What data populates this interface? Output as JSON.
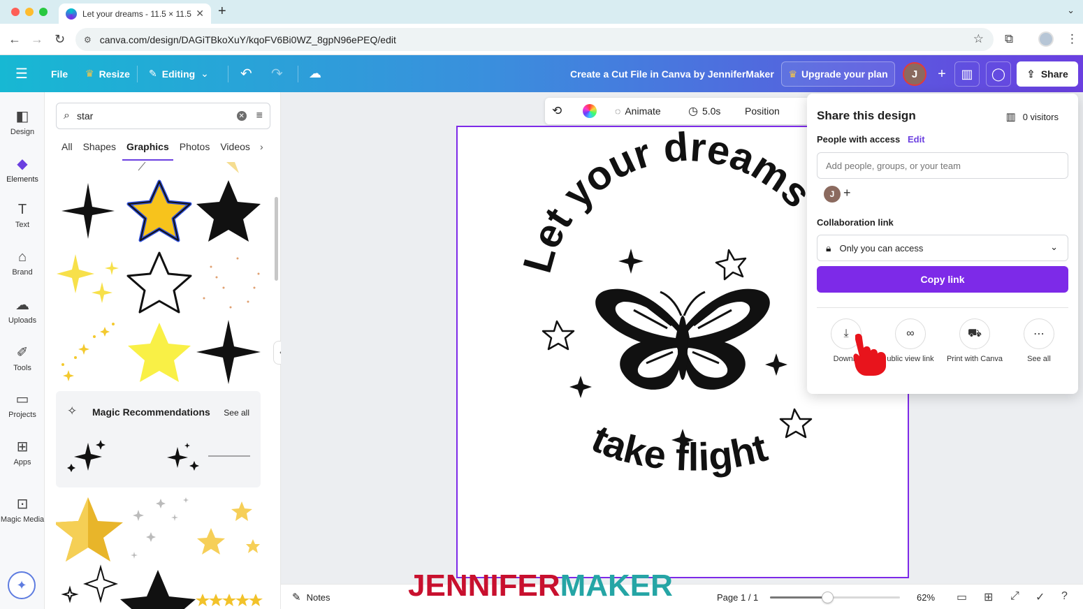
{
  "browser": {
    "tab_title": "Let your dreams - 11.5 × 11.5",
    "url": "canva.com/design/DAGiTBkoXuY/kqoFV6Bi0WZ_8gpN96ePEQ/edit",
    "new_tab": "+",
    "tab_close": "✕"
  },
  "header": {
    "file": "File",
    "resize": "Resize",
    "editing": "Editing",
    "title": "Create a Cut File in Canva by JenniferMaker",
    "upgrade": "Upgrade your plan",
    "avatar_initial": "J",
    "share": "Share"
  },
  "rail": {
    "items": [
      {
        "label": "Design",
        "icon": "design-icon"
      },
      {
        "label": "Elements",
        "icon": "elements-icon"
      },
      {
        "label": "Text",
        "icon": "text-icon"
      },
      {
        "label": "Brand",
        "icon": "brand-icon"
      },
      {
        "label": "Uploads",
        "icon": "uploads-icon"
      },
      {
        "label": "Tools",
        "icon": "tools-icon"
      },
      {
        "label": "Projects",
        "icon": "projects-icon"
      },
      {
        "label": "Apps",
        "icon": "apps-icon"
      },
      {
        "label": "Magic Media",
        "icon": "magic-media-icon"
      }
    ]
  },
  "panel": {
    "search_value": "star",
    "tabs": [
      "All",
      "Shapes",
      "Graphics",
      "Photos",
      "Videos"
    ],
    "active_tab": "Graphics",
    "magic_title": "Magic Recommendations",
    "see_all": "See all"
  },
  "toolbar": {
    "animate": "Animate",
    "duration": "5.0s",
    "position": "Position"
  },
  "design": {
    "top_text": "Let your dreams",
    "bottom_text": "take flight"
  },
  "bottom": {
    "notes": "Notes",
    "page": "Page 1 / 1",
    "zoom": "62%",
    "zoom_level": 0.62
  },
  "watermark": {
    "part1": "JENNIFER",
    "part2": "MAKER"
  },
  "share_panel": {
    "title": "Share this design",
    "visitors": "0 visitors",
    "people_access": "People with access",
    "edit": "Edit",
    "input_placeholder": "Add people, groups, or your team",
    "avatar_initial": "J",
    "collab_label": "Collaboration link",
    "access_option": "Only you can access",
    "copy_link": "Copy link",
    "actions": [
      {
        "label": "Downlo",
        "icon": "download-icon"
      },
      {
        "label": "ublic view link",
        "icon": "link-icon"
      },
      {
        "label": "Print with Canva",
        "icon": "truck-icon"
      },
      {
        "label": "See all",
        "icon": "more-icon"
      }
    ]
  },
  "colors": {
    "accent": "#7d2ae8",
    "header_start": "#17b8d3",
    "header_end": "#6a3fe0",
    "watermark_red": "#c8102e",
    "watermark_teal": "#25a5a5"
  }
}
